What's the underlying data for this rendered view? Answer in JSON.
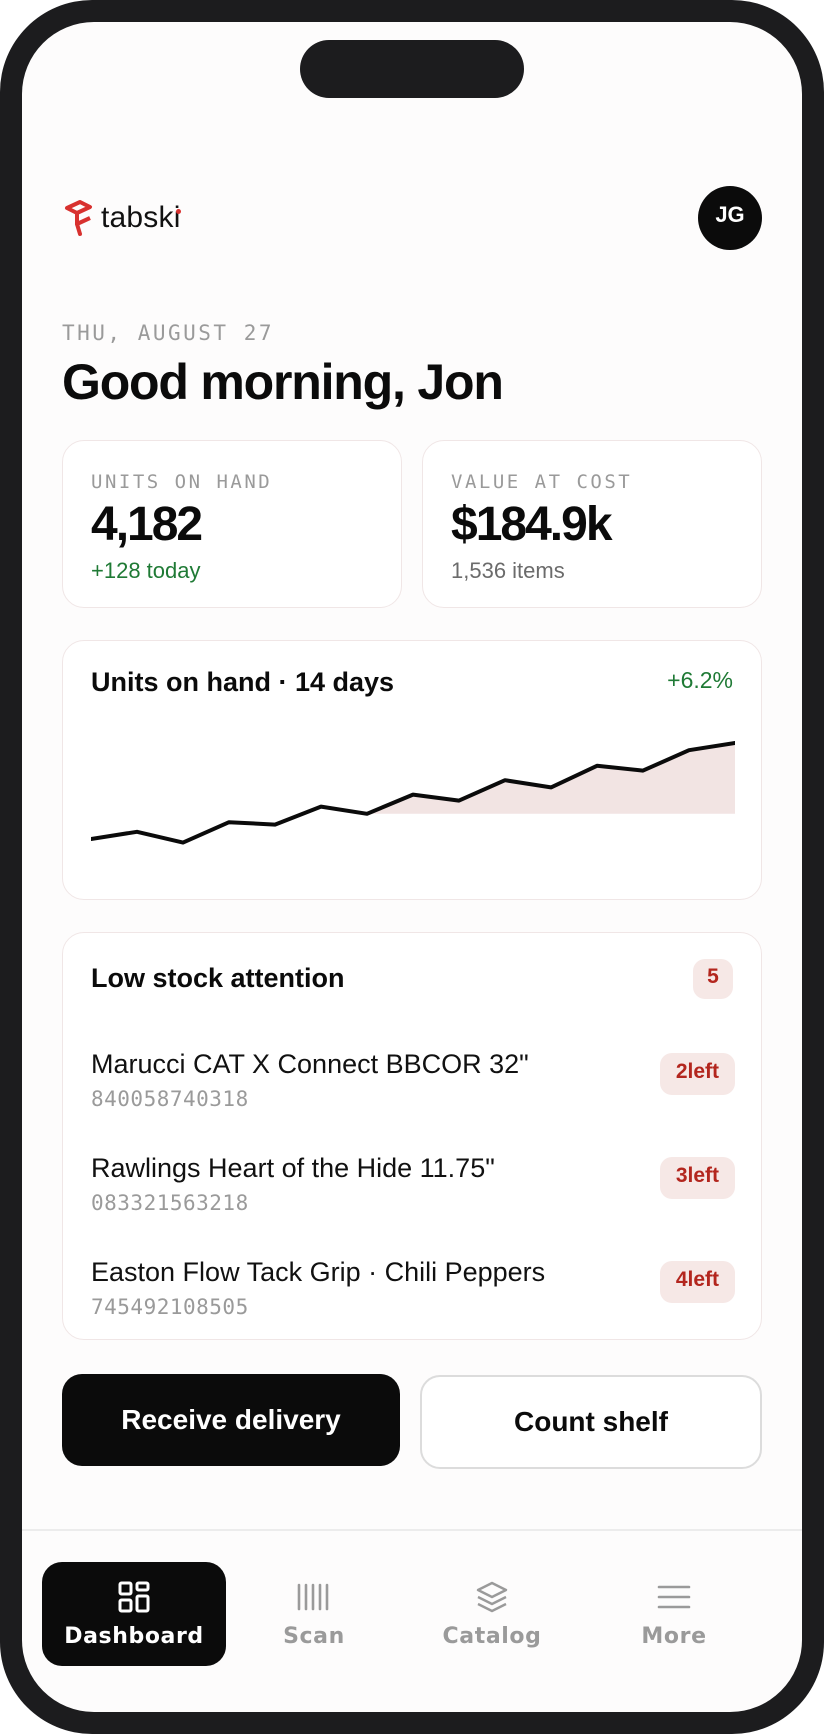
{
  "app": {
    "brand": "tabski",
    "avatar_initials": "JG"
  },
  "header": {
    "date": "THU, AUGUST 27",
    "greeting": "Good morning, Jon"
  },
  "stats": [
    {
      "label": "UNITS ON HAND",
      "value": "4,182",
      "sub": "+128 today"
    },
    {
      "label": "VALUE AT COST",
      "value": "$184.9k",
      "sub": "1,536 items"
    }
  ],
  "chart": {
    "title": "Units on hand · 14 days",
    "delta": "+6.2%"
  },
  "chart_data": {
    "type": "line",
    "title": "Units on hand · 14 days",
    "x": [
      1,
      2,
      3,
      4,
      5,
      6,
      7,
      8,
      9,
      10,
      11,
      12,
      13,
      14,
      15
    ],
    "values": [
      0,
      6,
      -3,
      14,
      12,
      27,
      21,
      37,
      32,
      49,
      43,
      61,
      57,
      74,
      80
    ],
    "ylim": [
      -10,
      90
    ],
    "grid": false,
    "line_color": "#0b0b0b",
    "fill_color": "#f2e4e3"
  },
  "low_stock": {
    "title": "Low stock attention",
    "count": "5",
    "items": [
      {
        "name": "Marucci CAT X Connect BBCOR 32\"",
        "code": "840058740318",
        "qty": "2left"
      },
      {
        "name": "Rawlings Heart of the Hide 11.75\"",
        "code": "083321563218",
        "qty": "3left"
      },
      {
        "name": "Easton Flow Tack Grip · Chili Peppers",
        "code": "745492108505",
        "qty": "4left"
      }
    ]
  },
  "actions": {
    "primary": "Receive delivery",
    "secondary": "Count shelf"
  },
  "nav": [
    {
      "label": "Dashboard",
      "icon": "grid-icon",
      "active": true
    },
    {
      "label": "Scan",
      "icon": "barcode-icon",
      "active": false
    },
    {
      "label": "Catalog",
      "icon": "layers-icon",
      "active": false
    },
    {
      "label": "More",
      "icon": "menu-icon",
      "active": false
    }
  ],
  "colors": {
    "accent": "#0b0b0b",
    "brand_red": "#d8312f",
    "positive": "#1f7a35",
    "warning_text": "#b3261e",
    "warning_bg": "#f6e8e6"
  }
}
